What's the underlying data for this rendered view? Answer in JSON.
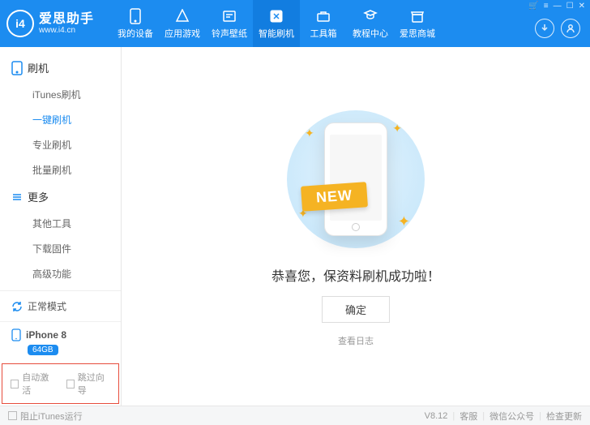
{
  "header": {
    "brand": "爱思助手",
    "site": "www.i4.cn",
    "logo_text": "i4",
    "nav": [
      {
        "label": "我的设备"
      },
      {
        "label": "应用游戏"
      },
      {
        "label": "铃声壁纸"
      },
      {
        "label": "智能刷机"
      },
      {
        "label": "工具箱"
      },
      {
        "label": "教程中心"
      },
      {
        "label": "爱思商城"
      }
    ]
  },
  "sidebar": {
    "cat1": "刷机",
    "subs1": [
      "iTunes刷机",
      "一键刷机",
      "专业刷机",
      "批量刷机"
    ],
    "cat2": "更多",
    "subs2": [
      "其他工具",
      "下载固件",
      "高级功能"
    ],
    "mode": "正常模式",
    "phone": "iPhone 8",
    "badge": "64GB",
    "chk1": "自动激活",
    "chk2": "跳过向导"
  },
  "main": {
    "ribbon": "NEW",
    "message": "恭喜您，保资料刷机成功啦！",
    "ok": "确定",
    "log": "查看日志"
  },
  "footer": {
    "chk": "阻止iTunes运行",
    "version": "V8.12",
    "f1": "客服",
    "f2": "微信公众号",
    "f3": "检查更新"
  }
}
